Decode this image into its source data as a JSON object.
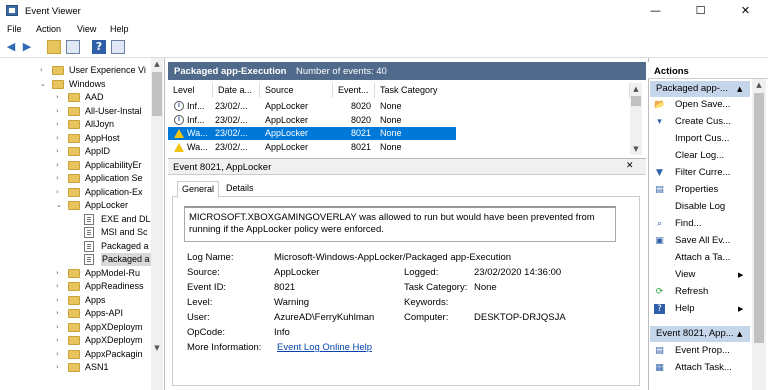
{
  "window": {
    "title": "Event Viewer",
    "minimize": "—",
    "maximize": "☐",
    "close": "✕"
  },
  "menu": [
    "File",
    "Action",
    "View",
    "Help"
  ],
  "toolbar": {
    "icons": [
      "back-icon",
      "forward-icon",
      "up-folder-icon",
      "show-hide-tree-icon",
      "help-icon",
      "show-hide-action-pane-icon"
    ]
  },
  "tree": [
    {
      "label": "User Experience Vi",
      "kind": "folder",
      "expand": "›",
      "indent": 0
    },
    {
      "label": "Windows",
      "kind": "folder",
      "expand": "⌄",
      "indent": 0
    },
    {
      "label": "AAD",
      "kind": "folder",
      "expand": "›",
      "indent": 1
    },
    {
      "label": "All-User-Instal",
      "kind": "folder",
      "expand": "›",
      "indent": 1
    },
    {
      "label": "AllJoyn",
      "kind": "folder",
      "expand": "›",
      "indent": 1
    },
    {
      "label": "AppHost",
      "kind": "folder",
      "expand": "›",
      "indent": 1
    },
    {
      "label": "AppID",
      "kind": "folder",
      "expand": "›",
      "indent": 1
    },
    {
      "label": "ApplicabilityEr",
      "kind": "folder",
      "expand": "›",
      "indent": 1
    },
    {
      "label": "Application Se",
      "kind": "folder",
      "expand": "›",
      "indent": 1
    },
    {
      "label": "Application-Ex",
      "kind": "folder",
      "expand": "›",
      "indent": 1
    },
    {
      "label": "AppLocker",
      "kind": "folder",
      "expand": "⌄",
      "indent": 1
    },
    {
      "label": "EXE and DL",
      "kind": "log",
      "expand": "",
      "indent": 2
    },
    {
      "label": "MSI and Sc",
      "kind": "log",
      "expand": "",
      "indent": 2
    },
    {
      "label": "Packaged a",
      "kind": "log",
      "expand": "",
      "indent": 2
    },
    {
      "label": "Packaged a",
      "kind": "log",
      "expand": "",
      "indent": 2,
      "selected": true
    },
    {
      "label": "AppModel-Ru",
      "kind": "folder",
      "expand": "›",
      "indent": 1
    },
    {
      "label": "AppReadiness",
      "kind": "folder",
      "expand": "›",
      "indent": 1
    },
    {
      "label": "Apps",
      "kind": "folder",
      "expand": "›",
      "indent": 1
    },
    {
      "label": "Apps-API",
      "kind": "folder",
      "expand": "›",
      "indent": 1
    },
    {
      "label": "AppXDeploym",
      "kind": "folder",
      "expand": "›",
      "indent": 1
    },
    {
      "label": "AppXDeploym",
      "kind": "folder",
      "expand": "›",
      "indent": 1
    },
    {
      "label": "AppxPackagin",
      "kind": "folder",
      "expand": "›",
      "indent": 1
    },
    {
      "label": "ASN1",
      "kind": "folder",
      "expand": "›",
      "indent": 1
    }
  ],
  "list": {
    "log_name": "Packaged app-Execution",
    "count_label": "Number of events: 40",
    "columns": [
      "Level",
      "Date a...",
      "Source",
      "Event...",
      "Task Category"
    ],
    "rows": [
      {
        "icon": "info",
        "level": "Inf...",
        "date": "23/02/...",
        "source": "AppLocker",
        "event": "8020",
        "task": "None"
      },
      {
        "icon": "info",
        "level": "Inf...",
        "date": "23/02/...",
        "source": "AppLocker",
        "event": "8020",
        "task": "None"
      },
      {
        "icon": "warn",
        "level": "Wa...",
        "date": "23/02/...",
        "source": "AppLocker",
        "event": "8021",
        "task": "None",
        "selected": true
      },
      {
        "icon": "warn",
        "level": "Wa...",
        "date": "23/02/...",
        "source": "AppLocker",
        "event": "8021",
        "task": "None"
      }
    ]
  },
  "detail": {
    "title": "Event 8021, AppLocker",
    "close": "✕",
    "tabs": [
      "General",
      "Details"
    ],
    "description": "MICROSOFT.XBOXGAMINGOVERLAY was allowed to run but would have been prevented from running if the AppLocker policy were enforced.",
    "fields": {
      "log_name_label": "Log Name:",
      "log_name": "Microsoft-Windows-AppLocker/Packaged app-Execution",
      "source_label": "Source:",
      "source": "AppLocker",
      "logged_label": "Logged:",
      "logged": "23/02/2020 14:36:00",
      "event_id_label": "Event ID:",
      "event_id": "8021",
      "task_label": "Task Category:",
      "task": "None",
      "level_label": "Level:",
      "level": "Warning",
      "keywords_label": "Keywords:",
      "keywords": "",
      "user_label": "User:",
      "user": "AzureAD\\FerryKuhlman",
      "computer_label": "Computer:",
      "computer": "DESKTOP-DRJQSJA",
      "opcode_label": "OpCode:",
      "opcode": "Info",
      "more_label": "More Information:",
      "more_link": "Event Log Online Help"
    }
  },
  "actions": {
    "title": "Actions",
    "section1": "Packaged app-...",
    "items1": [
      {
        "label": "Open Save...",
        "icon": "open-saved-log-icon",
        "glyph": "📂"
      },
      {
        "label": "Create Cus...",
        "icon": "create-custom-view-icon",
        "glyph": "▾"
      },
      {
        "label": "Import Cus...",
        "icon": "",
        "glyph": ""
      },
      {
        "label": "Clear Log...",
        "icon": "",
        "glyph": ""
      },
      {
        "label": "Filter Curre...",
        "icon": "filter-icon",
        "glyph": "▼"
      },
      {
        "label": "Properties",
        "icon": "properties-icon",
        "glyph": "▤"
      },
      {
        "label": "Disable Log",
        "icon": "",
        "glyph": ""
      },
      {
        "label": "Find...",
        "icon": "find-icon",
        "glyph": "⌕"
      },
      {
        "label": "Save All Ev...",
        "icon": "save-icon",
        "glyph": "▣"
      },
      {
        "label": "Attach a Ta...",
        "icon": "",
        "glyph": ""
      },
      {
        "label": "View",
        "icon": "",
        "glyph": "",
        "submenu": "▶"
      },
      {
        "label": "Refresh",
        "icon": "refresh-icon",
        "glyph": "⟳"
      },
      {
        "label": "Help",
        "icon": "help-icon",
        "glyph": "?",
        "submenu": "▶"
      }
    ],
    "section2": "Event 8021, App...",
    "items2": [
      {
        "label": "Event Prop...",
        "icon": "event-properties-icon",
        "glyph": "▤"
      },
      {
        "label": "Attach Task...",
        "icon": "attach-task-icon",
        "glyph": "▦"
      }
    ]
  },
  "colors": {
    "accent": "#0078d7",
    "header": "#4f6a8a",
    "action_header": "#c5d5ea",
    "link": "#0645ad"
  }
}
